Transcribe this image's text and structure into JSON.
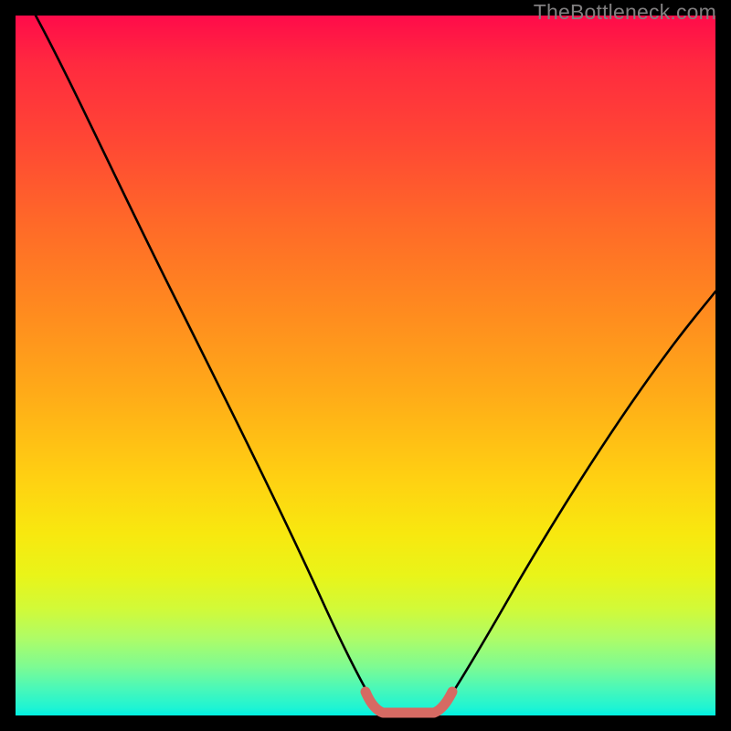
{
  "watermark": "TheBottleneck.com",
  "chart_data": {
    "type": "line",
    "title": "",
    "xlabel": "",
    "ylabel": "",
    "xlim": [
      0,
      100
    ],
    "ylim": [
      0,
      100
    ],
    "background_gradient": {
      "top_color": "#ff0b4a",
      "bottom_color": "#00f0e2",
      "meaning": "red-high to green-low"
    },
    "series": [
      {
        "name": "left-curve",
        "color": "#000000",
        "x": [
          3,
          8,
          13,
          18,
          23,
          28,
          33,
          38,
          43,
          47,
          50,
          52
        ],
        "y": [
          100,
          90,
          80,
          70,
          60,
          50,
          40,
          30,
          20,
          10,
          3,
          0
        ]
      },
      {
        "name": "right-curve",
        "color": "#000000",
        "x": [
          60,
          63,
          67,
          72,
          78,
          85,
          93,
          100
        ],
        "y": [
          0,
          3,
          10,
          20,
          30,
          40,
          50,
          58
        ]
      },
      {
        "name": "bottom-segment",
        "color": "#d66a63",
        "x": [
          50,
          52,
          54,
          56,
          58,
          60
        ],
        "y": [
          3,
          0,
          0,
          0,
          0,
          3
        ]
      }
    ],
    "annotations": []
  }
}
